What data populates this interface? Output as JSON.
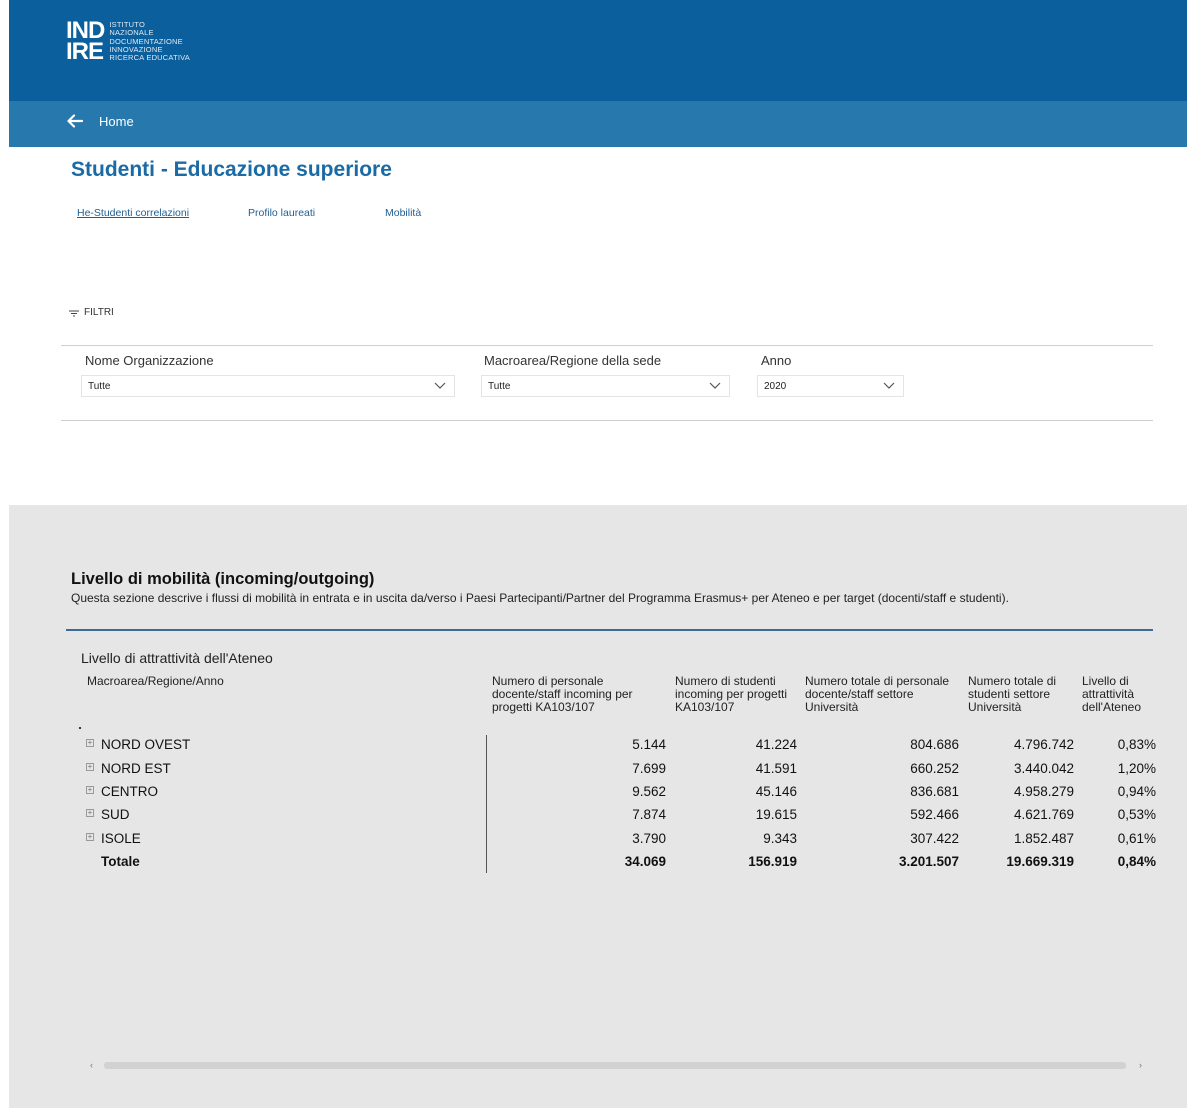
{
  "header": {
    "logo_big_line1": "IND",
    "logo_big_line2": "IRE",
    "logo_small": [
      "ISTITUTO",
      "NAZIONALE",
      "DOCUMENTAZIONE",
      "INNOVAZIONE",
      "RICERCA EDUCATIVA"
    ],
    "home_label": "Home",
    "brand_color": "#0b5f9c",
    "nav_color": "#2779ad"
  },
  "page": {
    "title": "Studenti - Educazione superiore",
    "tabs": [
      {
        "label": "He-Studenti correlazioni",
        "active": true
      },
      {
        "label": "Profilo laureati",
        "active": false
      },
      {
        "label": "Mobilità",
        "active": false
      }
    ]
  },
  "filters": {
    "toggle_label": "FILTRI",
    "items": [
      {
        "label": "Nome Organizzazione",
        "value": "Tutte"
      },
      {
        "label": "Macroarea/Regione della sede",
        "value": "Tutte"
      },
      {
        "label": "Anno",
        "value": "2020"
      }
    ]
  },
  "section": {
    "title": "Livello di mobilità (incoming/outgoing)",
    "description": "Questa sezione descrive i flussi di mobilità in entrata e in uscita da/verso i Paesi Partecipanti/Partner del Programma Erasmus+ per Ateneo e per target (docenti/staff e studenti)."
  },
  "table": {
    "title": "Livello di attrattività dell'Ateneo",
    "columns": [
      "Macroarea/Regione/Anno",
      "Numero di personale docente/staff incoming per progetti KA103/107",
      "Numero di studenti incoming per progetti KA103/107",
      "Numero totale di personale docente/staff settore Università",
      "Numero totale di studenti settore Università",
      "Livello di attrattività dell'Ateneo"
    ],
    "rows": [
      {
        "name": "NORD OVEST",
        "values": [
          "5.144",
          "41.224",
          "804.686",
          "4.796.742",
          "0,83%"
        ]
      },
      {
        "name": "NORD EST",
        "values": [
          "7.699",
          "41.591",
          "660.252",
          "3.440.042",
          "1,20%"
        ]
      },
      {
        "name": "CENTRO",
        "values": [
          "9.562",
          "45.146",
          "836.681",
          "4.958.279",
          "0,94%"
        ]
      },
      {
        "name": "SUD",
        "values": [
          "7.874",
          "19.615",
          "592.466",
          "4.621.769",
          "0,53%"
        ]
      },
      {
        "name": "ISOLE",
        "values": [
          "3.790",
          "9.343",
          "307.422",
          "1.852.487",
          "0,61%"
        ]
      }
    ],
    "total": {
      "name": "Totale",
      "values": [
        "34.069",
        "156.919",
        "3.201.507",
        "19.669.319",
        "0,84%"
      ]
    }
  }
}
